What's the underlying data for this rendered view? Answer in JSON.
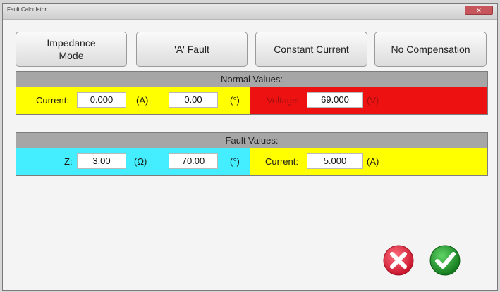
{
  "window": {
    "title": "Fault Calculator",
    "close_label": "✕"
  },
  "modes": {
    "impedance_mode": "Impedance\nMode",
    "fault_type": "'A' Fault",
    "constant": "Constant Current",
    "compensation": "No Compensation"
  },
  "normal": {
    "title": "Normal Values:",
    "current_label": "Current:",
    "current_value": "0.000",
    "current_unit": "(A)",
    "angle_value": "0.00",
    "angle_unit": "(°)",
    "voltage_label": "Voltage:",
    "voltage_value": "69.000",
    "voltage_unit": "(V)"
  },
  "fault": {
    "title": "Fault Values:",
    "z_label": "Z:",
    "z_value": "3.00",
    "z_unit": "(Ω)",
    "angle_value": "70.00",
    "angle_unit": "(°)",
    "current_label": "Current:",
    "current_value": "5.000",
    "current_unit": "(A)"
  },
  "actions": {
    "cancel_icon": "cancel-x-icon",
    "ok_icon": "confirm-check-icon"
  },
  "colors": {
    "yellow": "#ffff00",
    "red": "#ee1111",
    "cyan": "#44eeff",
    "cancel_red": "#d5243a",
    "ok_green": "#1f9a2a"
  }
}
